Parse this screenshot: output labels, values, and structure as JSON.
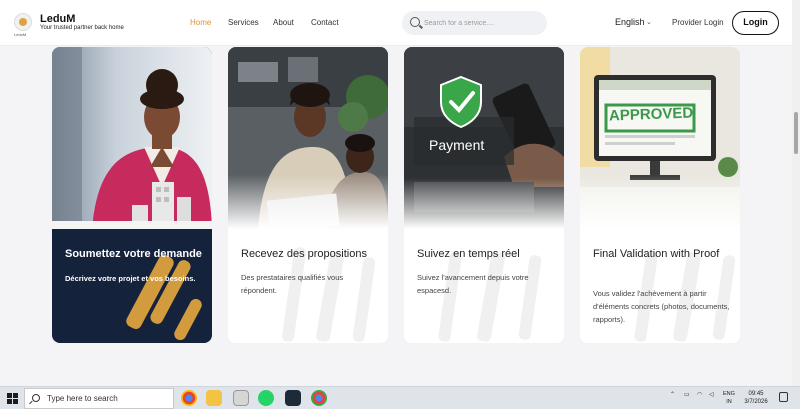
{
  "header": {
    "logo_text": "LeduM",
    "brand_name": "LeduM",
    "tagline": "Your trusted partner back home",
    "nav": [
      {
        "label": "Home",
        "active": true
      },
      {
        "label": "Services",
        "active": false
      },
      {
        "label": "About",
        "active": false
      },
      {
        "label": "Contact",
        "active": false
      }
    ],
    "search_placeholder": "Search for a service....",
    "language": "English",
    "provider_login": "Provider Login",
    "login": "Login",
    "accent_color": "#d9953b"
  },
  "cards": [
    {
      "title": "Soumettez votre demande",
      "description": "Décrivez votre projet et vos besoins.",
      "image": "woman-with-house-model",
      "style": "navy"
    },
    {
      "title": "Recevez des propositions",
      "description": "Des prestataires qualifiés vous répondent.",
      "image": "women-reviewing-documents",
      "style": "light"
    },
    {
      "title": "Suivez en temps réel",
      "description": "Suivez l'avancement depuis votre espacesd.",
      "image": "payment-shield-phone",
      "image_text": "Payment",
      "style": "light"
    },
    {
      "title": "Final Validation with Proof",
      "description": "Vous validez l'achèvement à partir d'éléments concrets (photos, documents, rapports).",
      "image": "approved-monitor",
      "image_text": "APPROVED",
      "style": "light"
    }
  ],
  "taskbar": {
    "search_placeholder": "Type here to search",
    "apps": [
      "chrome-icon",
      "file-explorer-icon",
      "files-icon",
      "whatsapp-icon",
      "terminal-icon",
      "chrome-profile-icon"
    ],
    "language": "ENG",
    "region": "IN",
    "time": "09:45",
    "date": "3/7/2026"
  }
}
